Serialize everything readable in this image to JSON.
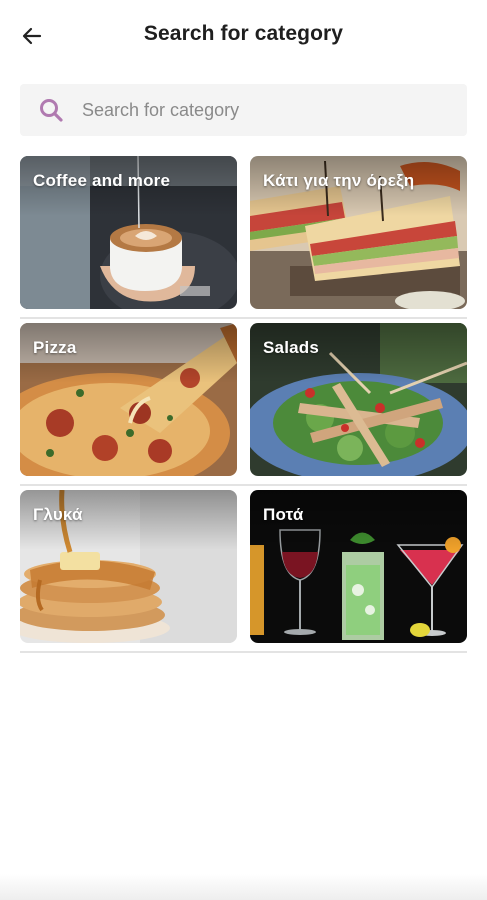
{
  "header": {
    "title": "Search for category",
    "back_icon": "arrow-left-icon"
  },
  "search": {
    "placeholder": "Search for category",
    "icon": "search-icon",
    "icon_color": "#b07ab0"
  },
  "categories": [
    {
      "label": "Coffee and more"
    },
    {
      "label": "Κάτι για την όρεξη"
    },
    {
      "label": "Pizza"
    },
    {
      "label": "Salads"
    },
    {
      "label": "Γλυκά"
    },
    {
      "label": "Ποτά"
    }
  ]
}
